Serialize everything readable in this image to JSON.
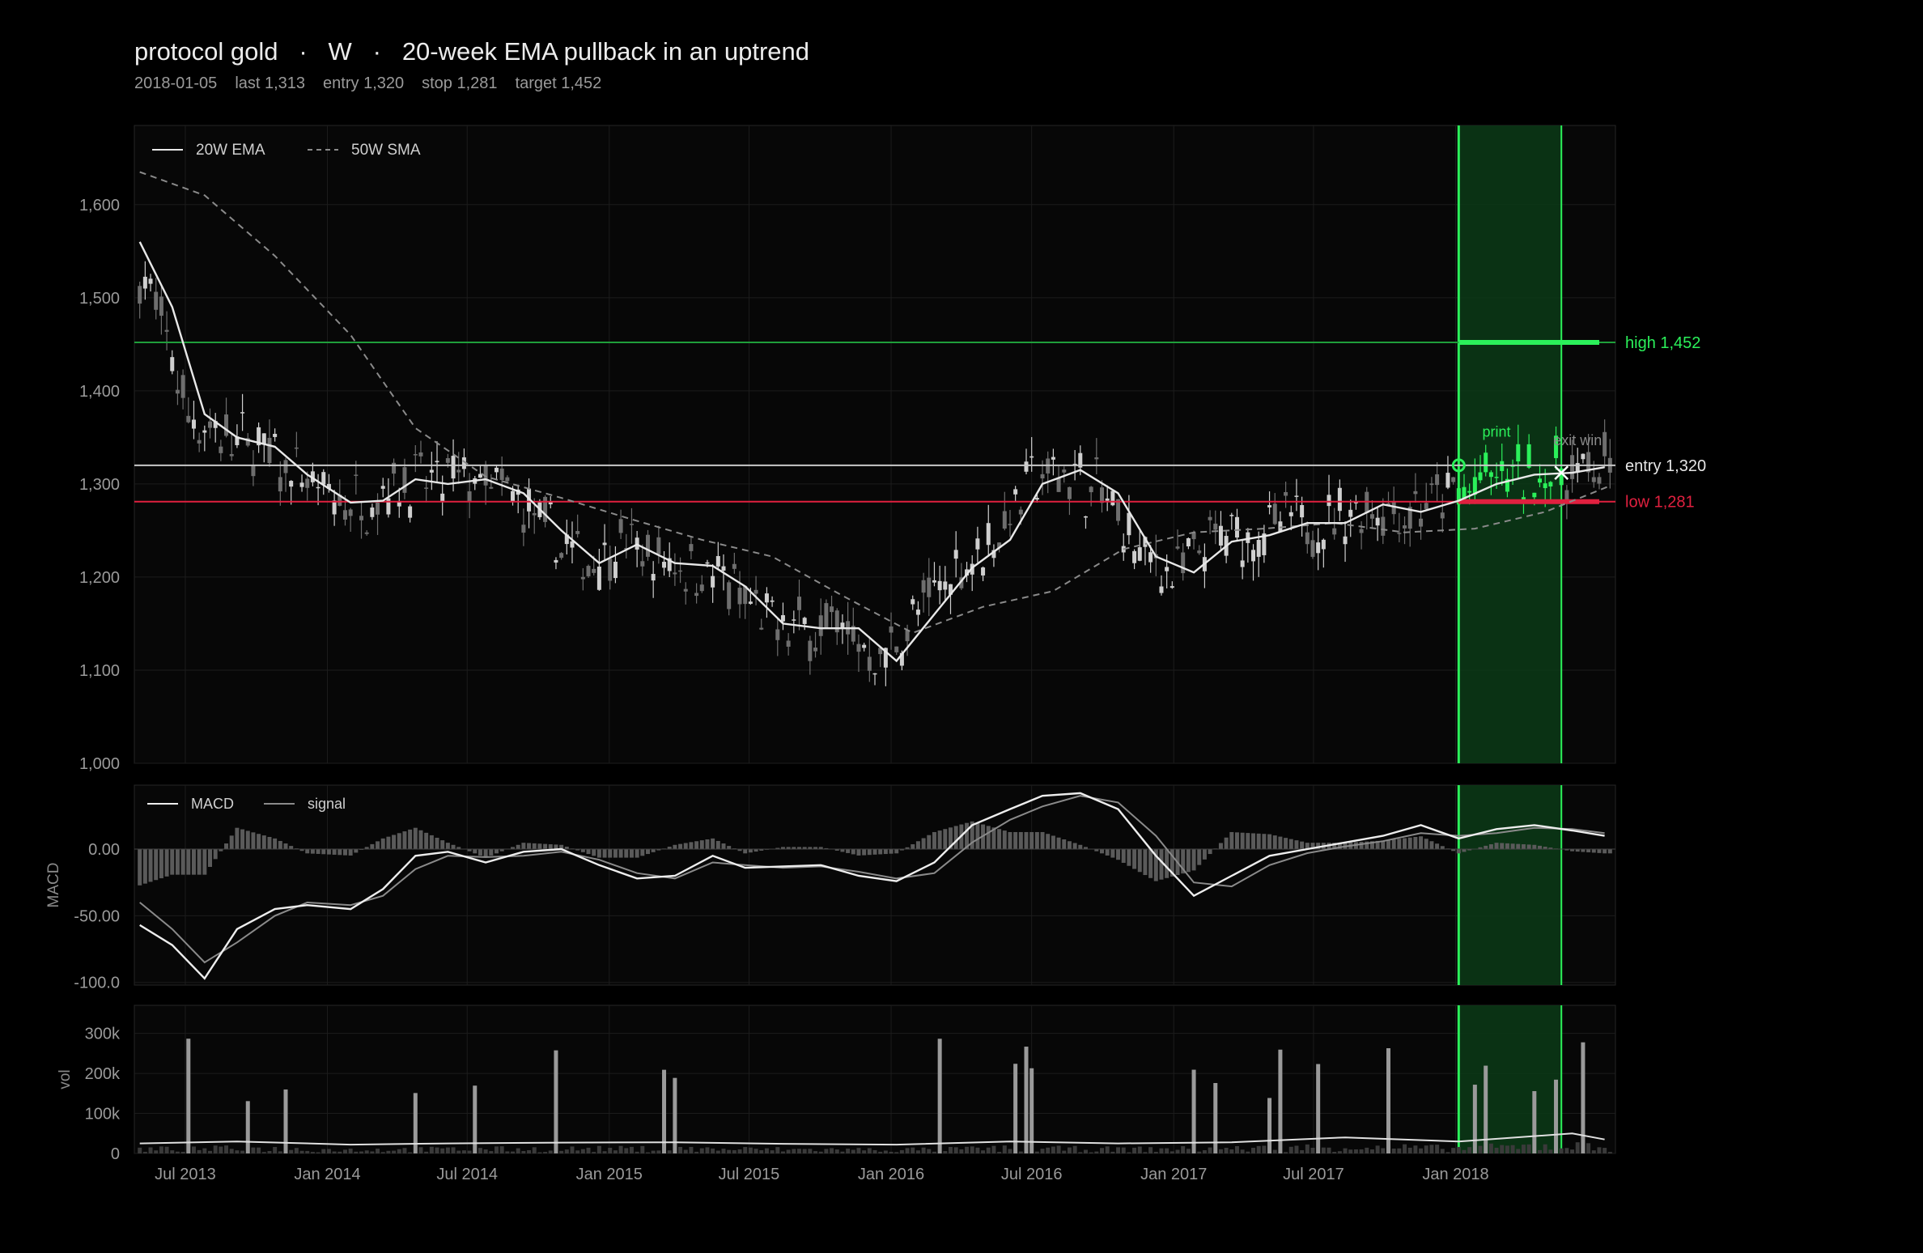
{
  "header": {
    "title_parts": [
      "protocol gold",
      "·",
      "W",
      "·",
      "20-week EMA pullback in an uptrend"
    ],
    "subtitle_items": [
      "2018-01-05",
      "last 1,313",
      "entry 1,320",
      "stop 1,281",
      "target 1,452"
    ]
  },
  "colors": {
    "background": "#000000",
    "panel": "#070707",
    "grid": "#1c1c1c",
    "candle": "#8a8a8a",
    "ema": "#e8e8e8",
    "sma": "#8a8a8a",
    "target_green": "#1f9e3a",
    "window_green": "#2bf05a",
    "stop_red": "#e0203f",
    "entry_gray": "#c8c8c8"
  },
  "chart_data": [
    {
      "type": "candlestick",
      "panel": "price",
      "x_tick_labels": [
        "Jul 2013",
        "Jan 2014",
        "Jul 2014",
        "Jan 2015",
        "Jul 2015",
        "Jan 2016",
        "Jul 2016",
        "Jan 2017",
        "Jul 2017",
        "Jan 2018"
      ],
      "x_tick_dates": [
        "2013-07-01",
        "2014-01-01",
        "2014-07-01",
        "2015-01-01",
        "2015-07-01",
        "2016-01-01",
        "2016-07-01",
        "2017-01-01",
        "2017-07-01",
        "2018-01-01"
      ],
      "x_range": [
        "2013-04-26",
        "2018-07-27"
      ],
      "ylim": [
        1000,
        1685
      ],
      "y_ticks": [
        1000,
        1100,
        1200,
        1300,
        1400,
        1500,
        1600
      ],
      "y_tick_labels": [
        "1,000",
        "1,100",
        "1,200",
        "1,300",
        "1,400",
        "1,500",
        "1,600"
      ],
      "grid": true,
      "legend": {
        "position": "top-left",
        "entries": [
          "20W EMA",
          "50W SMA"
        ]
      },
      "series": [
        {
          "name": "20W EMA",
          "style": "solid",
          "x": [
            "2013-05-03",
            "2013-06-14",
            "2013-07-26",
            "2013-09-06",
            "2013-10-25",
            "2013-12-06",
            "2014-01-31",
            "2014-03-14",
            "2014-04-25",
            "2014-06-06",
            "2014-07-25",
            "2014-09-12",
            "2014-10-31",
            "2014-12-19",
            "2015-02-06",
            "2015-03-27",
            "2015-05-15",
            "2015-06-26",
            "2015-08-14",
            "2015-10-02",
            "2015-11-20",
            "2016-01-08",
            "2016-02-26",
            "2016-04-15",
            "2016-06-03",
            "2016-07-15",
            "2016-09-02",
            "2016-10-21",
            "2016-12-09",
            "2017-01-27",
            "2017-03-17",
            "2017-05-05",
            "2017-06-23",
            "2017-08-11",
            "2017-09-29",
            "2017-11-17",
            "2018-01-05",
            "2018-02-23",
            "2018-04-13",
            "2018-06-01",
            "2018-07-13"
          ],
          "values": [
            1560,
            1490,
            1375,
            1350,
            1340,
            1310,
            1280,
            1282,
            1305,
            1300,
            1305,
            1290,
            1250,
            1215,
            1235,
            1215,
            1212,
            1190,
            1150,
            1145,
            1145,
            1110,
            1160,
            1210,
            1240,
            1300,
            1315,
            1290,
            1222,
            1205,
            1238,
            1245,
            1258,
            1258,
            1278,
            1270,
            1282,
            1300,
            1310,
            1312,
            1318
          ]
        },
        {
          "name": "50W SMA",
          "style": "dashed",
          "x": [
            "2013-05-03",
            "2013-07-26",
            "2013-10-25",
            "2014-01-31",
            "2014-04-25",
            "2014-07-25",
            "2014-10-31",
            "2015-01-30",
            "2015-05-01",
            "2015-07-31",
            "2015-10-30",
            "2016-01-29",
            "2016-04-29",
            "2016-07-29",
            "2016-10-28",
            "2017-01-27",
            "2017-04-28",
            "2017-07-28",
            "2017-10-27",
            "2018-01-26",
            "2018-04-27",
            "2018-07-20"
          ],
          "values": [
            1635,
            1610,
            1545,
            1460,
            1360,
            1308,
            1285,
            1262,
            1240,
            1222,
            1180,
            1140,
            1168,
            1185,
            1230,
            1248,
            1252,
            1258,
            1248,
            1252,
            1270,
            1298
          ]
        }
      ],
      "levels": [
        {
          "name": "target",
          "label": "high",
          "value": 1452,
          "value_label": "1,452",
          "color": "#1f9e3a"
        },
        {
          "name": "entry",
          "label": "entry",
          "value": 1320,
          "value_label": "1,320",
          "color": "#c8c8c8"
        },
        {
          "name": "stop",
          "label": "low",
          "value": 1281,
          "value_label": "1,281",
          "color": "#e0203f"
        }
      ],
      "trade_window": {
        "start": "2018-01-05",
        "end": "2018-05-18"
      },
      "annotations": [
        {
          "text": "print",
          "x": "2018-02-23",
          "y": 1342,
          "color": "#2bf05a"
        },
        {
          "text": "exit win",
          "x": "2018-06-08",
          "y": 1333,
          "color": "#8a8a8a"
        }
      ],
      "markers": [
        {
          "kind": "entry-circle",
          "x": "2018-01-05",
          "y": 1320
        },
        {
          "kind": "exit-x",
          "x": "2018-05-18",
          "y": 1312
        }
      ]
    },
    {
      "type": "line",
      "panel": "macd",
      "ylabel": "MACD",
      "ylim": [
        -102,
        48
      ],
      "y_ticks": [
        -100,
        -50,
        0
      ],
      "y_tick_labels": [
        "-100.0",
        "-50.00",
        "0.00"
      ],
      "legend": {
        "position": "top-left",
        "entries": [
          "MACD",
          "signal"
        ]
      },
      "series": [
        {
          "name": "MACD",
          "x": [
            "2013-05-03",
            "2013-06-14",
            "2013-07-26",
            "2013-09-06",
            "2013-10-25",
            "2013-12-06",
            "2014-01-31",
            "2014-03-14",
            "2014-04-25",
            "2014-06-06",
            "2014-07-25",
            "2014-09-12",
            "2014-10-31",
            "2014-12-19",
            "2015-02-06",
            "2015-03-27",
            "2015-05-15",
            "2015-06-26",
            "2015-08-14",
            "2015-10-02",
            "2015-11-20",
            "2016-01-08",
            "2016-02-26",
            "2016-04-15",
            "2016-06-03",
            "2016-07-15",
            "2016-09-02",
            "2016-10-21",
            "2016-12-09",
            "2017-01-27",
            "2017-03-17",
            "2017-05-05",
            "2017-06-23",
            "2017-08-11",
            "2017-09-29",
            "2017-11-17",
            "2018-01-05",
            "2018-02-23",
            "2018-04-13",
            "2018-06-01",
            "2018-07-13"
          ],
          "values": [
            -57,
            -72,
            -97,
            -60,
            -45,
            -42,
            -45,
            -30,
            -5,
            -2,
            -10,
            -2,
            0,
            -12,
            -22,
            -20,
            -5,
            -14,
            -13,
            -12,
            -20,
            -24,
            -10,
            18,
            30,
            40,
            42,
            30,
            -5,
            -35,
            -20,
            -5,
            0,
            5,
            10,
            18,
            8,
            15,
            18,
            14,
            10
          ]
        },
        {
          "name": "signal",
          "x": [
            "2013-05-03",
            "2013-06-14",
            "2013-07-26",
            "2013-09-06",
            "2013-10-25",
            "2013-12-06",
            "2014-01-31",
            "2014-03-14",
            "2014-04-25",
            "2014-06-06",
            "2014-07-25",
            "2014-09-12",
            "2014-10-31",
            "2014-12-19",
            "2015-02-06",
            "2015-03-27",
            "2015-05-15",
            "2015-06-26",
            "2015-08-14",
            "2015-10-02",
            "2015-11-20",
            "2016-01-08",
            "2016-02-26",
            "2016-04-15",
            "2016-06-03",
            "2016-07-15",
            "2016-09-02",
            "2016-10-21",
            "2016-12-09",
            "2017-01-27",
            "2017-03-17",
            "2017-05-05",
            "2017-06-23",
            "2017-08-11",
            "2017-09-29",
            "2017-11-17",
            "2018-01-05",
            "2018-02-23",
            "2018-04-13",
            "2018-06-01",
            "2018-07-13"
          ],
          "values": [
            -40,
            -60,
            -85,
            -70,
            -50,
            -40,
            -42,
            -35,
            -15,
            -5,
            -6,
            -5,
            -2,
            -8,
            -18,
            -22,
            -10,
            -12,
            -14,
            -13,
            -17,
            -22,
            -18,
            5,
            22,
            32,
            40,
            35,
            10,
            -25,
            -28,
            -12,
            -3,
            2,
            6,
            12,
            10,
            12,
            16,
            15,
            12
          ]
        }
      ]
    },
    {
      "type": "bar",
      "panel": "volume",
      "ylabel": "vol",
      "ylim": [
        0,
        370000
      ],
      "y_ticks": [
        0,
        100000,
        200000,
        300000
      ],
      "y_tick_labels": [
        "0",
        "100k",
        "200k",
        "300k"
      ],
      "series": [
        {
          "name": "volume average",
          "style": "line",
          "x": [
            "2013-05-03",
            "2013-09-06",
            "2014-01-31",
            "2014-06-06",
            "2014-10-31",
            "2015-03-27",
            "2015-08-14",
            "2016-01-08",
            "2016-06-03",
            "2016-10-21",
            "2017-03-17",
            "2017-08-11",
            "2018-01-05",
            "2018-06-01",
            "2018-07-13"
          ],
          "values": [
            25000,
            30000,
            22000,
            25000,
            27000,
            28000,
            24000,
            22000,
            30000,
            25000,
            28000,
            40000,
            30000,
            50000,
            35000
          ]
        }
      ]
    }
  ]
}
